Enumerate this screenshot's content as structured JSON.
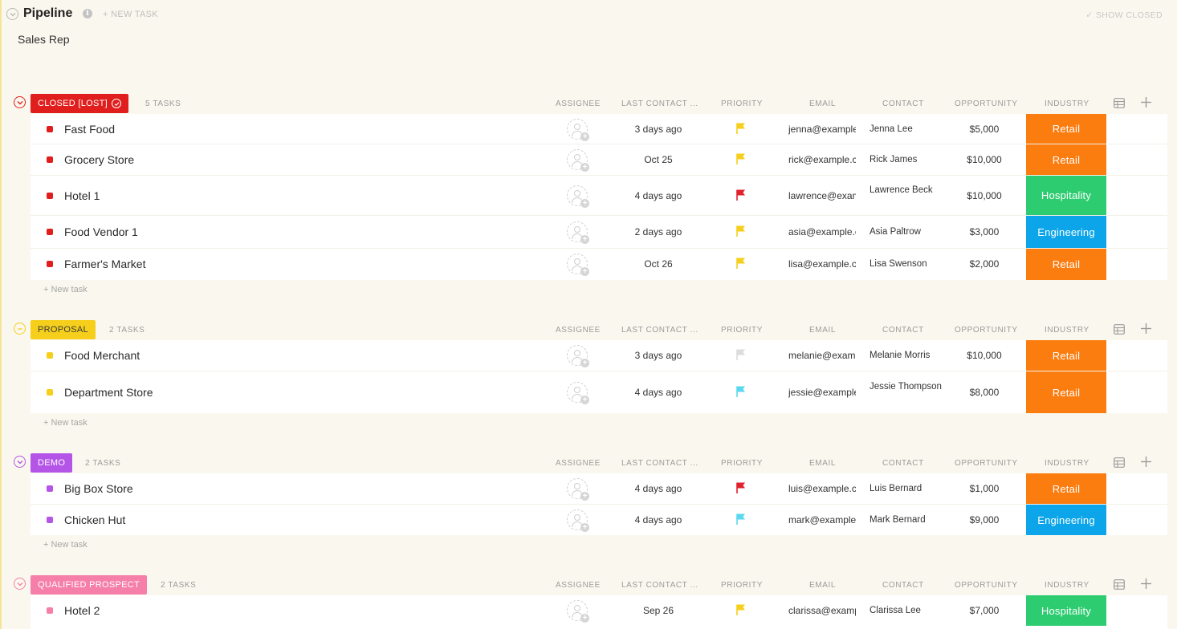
{
  "header": {
    "title": "Pipeline",
    "new_task_label": "+ NEW TASK",
    "show_closed_label": "✓ SHOW CLOSED",
    "subtitle": "Sales Rep"
  },
  "columns": {
    "assignee": "ASSIGNEE",
    "last_contact": "LAST CONTACT ...",
    "priority": "PRIORITY",
    "email": "EMAIL",
    "contact": "CONTACT",
    "opportunity": "OPPORTUNITY",
    "industry": "INDUSTRY"
  },
  "colors": {
    "closed_lost": "#e01e1e",
    "proposal": "#f5cf1b",
    "demo": "#b455e8",
    "qualified_prospect": "#f57fa8",
    "retail": "#fb7c0f",
    "hospitality": "#2ecc71",
    "engineering": "#0ca5e9",
    "flag_yellow": "#f5cf1b",
    "flag_red": "#e0222e",
    "flag_cyan": "#5ad8ef",
    "flag_gray": "#dcdcdc"
  },
  "new_task_label": "+ New task",
  "groups": [
    {
      "status": "CLOSED [LOST]",
      "count": "5 TASKS",
      "tasks": [
        {
          "name": "Fast Food",
          "last_contact": "3 days ago",
          "priority": "yellow",
          "email": "jenna@example.com",
          "contact": "Jenna Lee",
          "opportunity": "$5,000",
          "industry": "Retail"
        },
        {
          "name": "Grocery Store",
          "last_contact": "Oct 25",
          "priority": "yellow",
          "email": "rick@example.com",
          "contact": "Rick James",
          "opportunity": "$10,000",
          "industry": "Retail"
        },
        {
          "name": "Hotel 1",
          "last_contact": "4 days ago",
          "priority": "red",
          "email": "lawrence@example.com",
          "contact": "Lawrence Beck",
          "opportunity": "$10,000",
          "industry": "Hospitality"
        },
        {
          "name": "Food Vendor 1",
          "last_contact": "2 days ago",
          "priority": "yellow",
          "email": "asia@example.com",
          "contact": "Asia Paltrow",
          "opportunity": "$3,000",
          "industry": "Engineering"
        },
        {
          "name": "Farmer's Market",
          "last_contact": "Oct 26",
          "priority": "yellow",
          "email": "lisa@example.com",
          "contact": "Lisa Swenson",
          "opportunity": "$2,000",
          "industry": "Retail"
        }
      ]
    },
    {
      "status": "PROPOSAL",
      "count": "2 TASKS",
      "tasks": [
        {
          "name": "Food Merchant",
          "last_contact": "3 days ago",
          "priority": "gray",
          "email": "melanie@example.com",
          "contact": "Melanie Morris",
          "opportunity": "$10,000",
          "industry": "Retail"
        },
        {
          "name": "Department Store",
          "last_contact": "4 days ago",
          "priority": "cyan",
          "email": "jessie@example.com",
          "contact": "Jessie Thompson",
          "opportunity": "$8,000",
          "industry": "Retail"
        }
      ]
    },
    {
      "status": "DEMO",
      "count": "2 TASKS",
      "tasks": [
        {
          "name": "Big Box Store",
          "last_contact": "4 days ago",
          "priority": "red",
          "email": "luis@example.com",
          "contact": "Luis Bernard",
          "opportunity": "$1,000",
          "industry": "Retail"
        },
        {
          "name": "Chicken Hut",
          "last_contact": "4 days ago",
          "priority": "cyan",
          "email": "mark@example.com",
          "contact": "Mark Bernard",
          "opportunity": "$9,000",
          "industry": "Engineering"
        }
      ]
    },
    {
      "status": "QUALIFIED PROSPECT",
      "count": "2 TASKS",
      "tasks": [
        {
          "name": "Hotel 2",
          "last_contact": "Sep 26",
          "priority": "yellow",
          "email": "clarissa@example.com",
          "contact": "Clarissa Lee",
          "opportunity": "$7,000",
          "industry": "Hospitality"
        }
      ]
    }
  ]
}
